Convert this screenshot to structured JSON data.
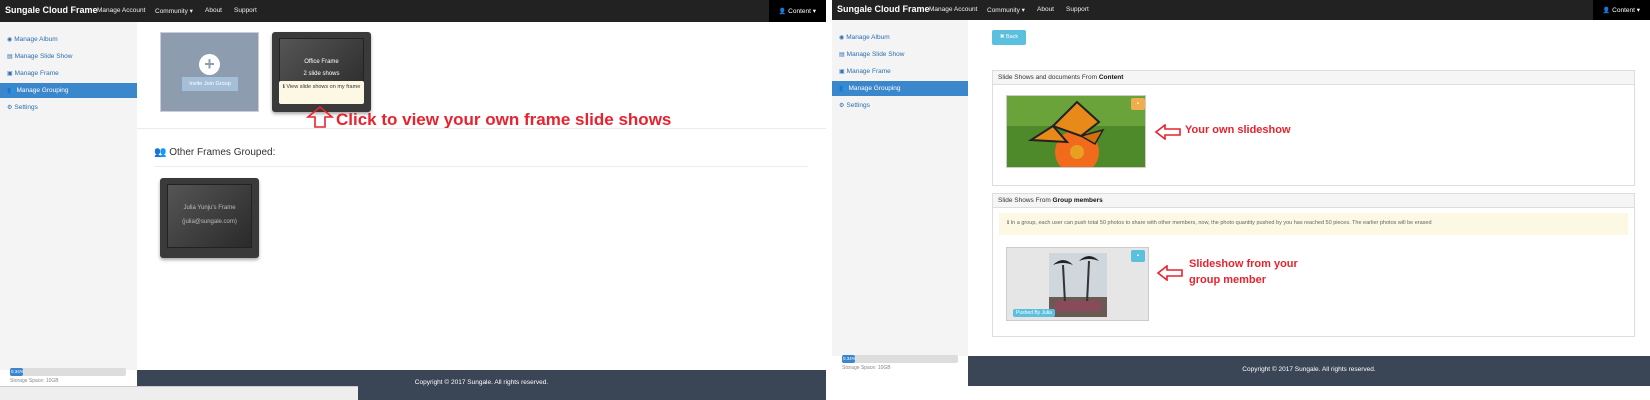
{
  "app": {
    "brand": "Sungale Cloud Frame",
    "menu": [
      "Manage Account",
      "Community ▾",
      "About",
      "Support"
    ],
    "account": "Content ▾"
  },
  "sidebar": {
    "items": [
      "Manage Album",
      "Manage Slide Show",
      "Manage Frame",
      "Manage Grouping",
      "Settings"
    ],
    "active": "Manage Grouping",
    "storage_percent_text": "0.34%",
    "storage_label": "Storage Space: 10GB"
  },
  "footer": {
    "copyright": "Copyright © 2017 Sungale. All rights reserved."
  },
  "left": {
    "invite_label": "Invite Join Group",
    "office_frame": {
      "name": "Office Frame",
      "count": "2 slide shows"
    },
    "tooltip": "View slide shows on my frame",
    "callout": "Click to view your own frame slide shows",
    "section_title": "Other Frames Grouped:",
    "other_frame": {
      "name": "Julia Yunju's Frame",
      "email": "(julia@sungale.com)"
    }
  },
  "right": {
    "back_label": "Back",
    "panel1_prefix": "Slide Shows and documents From ",
    "panel1_owner": "Content",
    "callout1": "Your own slideshow",
    "panel2_prefix": "Slide Shows From ",
    "panel2_owner": "Group members",
    "alert": "In a group, each user can push total 50 photos to share with other members, now, the photo quantity pushed by you has reached 50 pieces. The earlier photos will be erased",
    "pushed_by": "Pushed By Julia",
    "callout2_line1": "Slideshow from your",
    "callout2_line2": "group member"
  },
  "colors": {
    "accent": "#3a87cc",
    "callout": "#e8232f",
    "footer": "#3a4556",
    "info": "#5bc0de",
    "warn": "#f0ad4e"
  }
}
